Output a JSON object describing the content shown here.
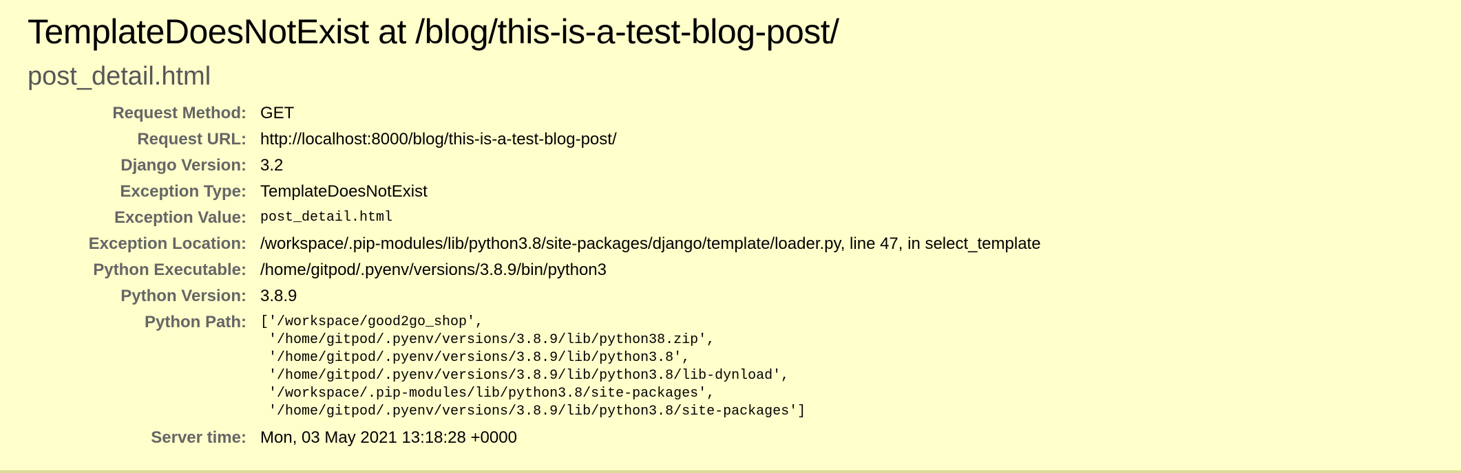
{
  "summary": {
    "title": "TemplateDoesNotExist at /blog/this-is-a-test-blog-post/",
    "subtitle": "post_detail.html"
  },
  "meta": {
    "request_method": {
      "label": "Request Method:",
      "value": "GET"
    },
    "request_url": {
      "label": "Request URL:",
      "value": "http://localhost:8000/blog/this-is-a-test-blog-post/"
    },
    "django_version": {
      "label": "Django Version:",
      "value": "3.2"
    },
    "exception_type": {
      "label": "Exception Type:",
      "value": "TemplateDoesNotExist"
    },
    "exception_value": {
      "label": "Exception Value:",
      "value": "post_detail.html"
    },
    "exception_location": {
      "label": "Exception Location:",
      "value": "/workspace/.pip-modules/lib/python3.8/site-packages/django/template/loader.py, line 47, in select_template"
    },
    "python_executable": {
      "label": "Python Executable:",
      "value": "/home/gitpod/.pyenv/versions/3.8.9/bin/python3"
    },
    "python_version": {
      "label": "Python Version:",
      "value": "3.8.9"
    },
    "python_path": {
      "label": "Python Path:",
      "lines": [
        "['/workspace/good2go_shop',",
        " '/home/gitpod/.pyenv/versions/3.8.9/lib/python38.zip',",
        " '/home/gitpod/.pyenv/versions/3.8.9/lib/python3.8',",
        " '/home/gitpod/.pyenv/versions/3.8.9/lib/python3.8/lib-dynload',",
        " '/workspace/.pip-modules/lib/python3.8/site-packages',",
        " '/home/gitpod/.pyenv/versions/3.8.9/lib/python3.8/site-packages']"
      ]
    },
    "server_time": {
      "label": "Server time:",
      "value": "Mon, 03 May 2021 13:18:28 +0000"
    }
  },
  "colors": {
    "background": "#ffffcc",
    "label": "#666666",
    "subtitle": "#575757",
    "rule": "#dddd99"
  }
}
